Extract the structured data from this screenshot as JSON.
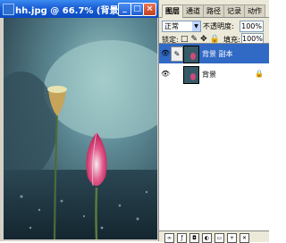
{
  "document": {
    "title": "hh.jpg @ 66.7% (背景 ...",
    "buttons": {
      "minimize": "_",
      "maximize": "□",
      "close": "×"
    }
  },
  "layers_panel": {
    "tabs": [
      "图层",
      "通道",
      "路径",
      "记录",
      "动作"
    ],
    "active_tab": "图层",
    "blend_mode": "正常",
    "opacity_label": "不透明度:",
    "opacity_value": "100%",
    "lock_label": "锁定:",
    "fill_label": "填充:",
    "fill_value": "100%",
    "layers": [
      {
        "name": "背景 副本",
        "selected": true,
        "visible": true
      },
      {
        "name": "背景",
        "selected": false,
        "visible": true,
        "locked": true
      }
    ]
  },
  "icons": {
    "eye": "eye-icon",
    "brush": "brush-icon",
    "lock": "lock-icon"
  },
  "colors": {
    "titlebar": "#1a5fd6",
    "selection": "#316ac5",
    "panel": "#ece9d8"
  }
}
